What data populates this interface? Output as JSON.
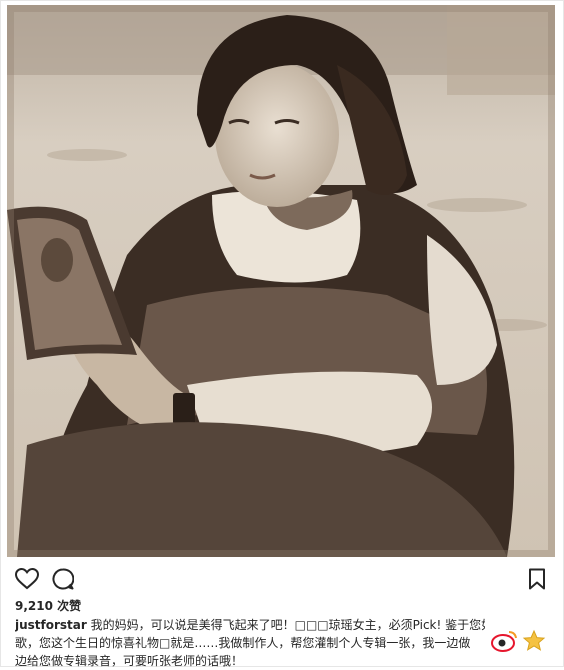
{
  "post": {
    "likes": "9,210 次赞",
    "caption": {
      "username": "justforstar",
      "line1": " 我的妈妈，可以说是美得飞起来了吧！□□□琼瑶女主，必须Pick! 鉴于您如此喜欢唱",
      "line2": "歌，您这个生日的惊喜礼物□就是……我做制作人，帮您灌制个人专辑一张，我一边做",
      "line3": "边给您做专辑录音，可要听张老师的话哦！"
    }
  },
  "icons": {
    "like": "heart-icon",
    "comment": "comment-icon",
    "save": "bookmark-icon",
    "watermark": "weibo-logo-icon"
  },
  "colors": {
    "text": "#262626",
    "border": "#e6e6e6",
    "sepia_dark": "#3a2c22",
    "sepia_light": "#d9cfc2"
  }
}
